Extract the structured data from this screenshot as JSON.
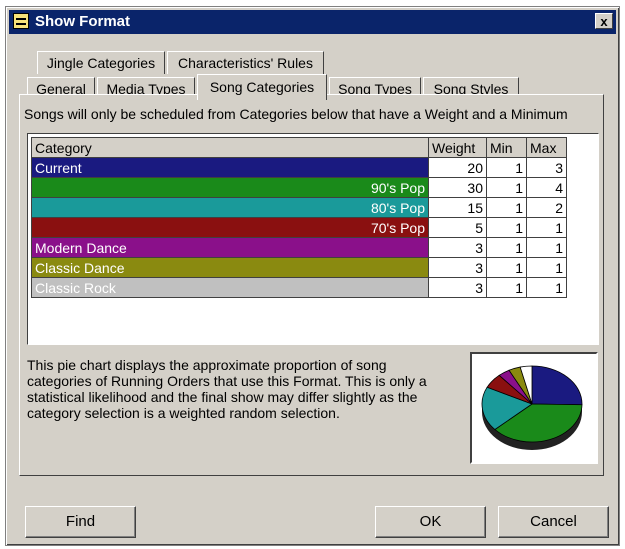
{
  "window": {
    "title": "Show Format",
    "close_label": "x"
  },
  "tabs": {
    "row1": [
      {
        "label": "Jingle Categories"
      },
      {
        "label": "Characteristics' Rules"
      }
    ],
    "row2": [
      {
        "label": "General"
      },
      {
        "label": "Media Types"
      },
      {
        "label": "Song Categories",
        "active": true
      },
      {
        "label": "Song Types"
      },
      {
        "label": "Song Styles"
      }
    ]
  },
  "info": "Songs will only be scheduled from Categories below that have a Weight and a Minimum",
  "grid": {
    "headers": [
      "Category",
      "Weight",
      "Min",
      "Max"
    ],
    "rows": [
      {
        "category": "Current",
        "weight": "20",
        "min": "1",
        "max": "3",
        "color": "#1a1a80",
        "text_color": "#ffffff",
        "align": "left"
      },
      {
        "category": "90's Pop",
        "weight": "30",
        "min": "1",
        "max": "4",
        "color": "#1a8a1a",
        "text_color": "#ffffff",
        "align": "right"
      },
      {
        "category": "80's Pop",
        "weight": "15",
        "min": "1",
        "max": "2",
        "color": "#1a9a9a",
        "text_color": "#ffffff",
        "align": "right"
      },
      {
        "category": "70's Pop",
        "weight": "5",
        "min": "1",
        "max": "1",
        "color": "#8a1010",
        "text_color": "#ffffff",
        "align": "right"
      },
      {
        "category": "Modern Dance",
        "weight": "3",
        "min": "1",
        "max": "1",
        "color": "#8a108a",
        "text_color": "#ffffff",
        "align": "left"
      },
      {
        "category": "Classic Dance",
        "weight": "3",
        "min": "1",
        "max": "1",
        "color": "#8a8a10",
        "text_color": "#ffffff",
        "align": "left"
      },
      {
        "category": "Classic Rock",
        "weight": "3",
        "min": "1",
        "max": "1",
        "color": "#c0c0c0",
        "text_color": "#ffffff",
        "align": "left"
      }
    ]
  },
  "description": [
    "This pie chart displays the approximate proportion of song",
    "categories of Running Orders that use this Format. This is only a",
    "statistical likelihood and the final show may differ slightly as the",
    "category selection is a weighted random selection."
  ],
  "buttons": {
    "find": "Find",
    "ok": "OK",
    "cancel": "Cancel"
  }
}
